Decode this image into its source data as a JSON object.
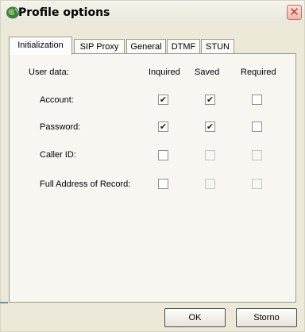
{
  "window": {
    "title": "Profile options",
    "close_glyph": "✕",
    "icon": "globe-icon"
  },
  "tabs": [
    {
      "label": "Initialization",
      "active": true
    },
    {
      "label": "SIP Proxy",
      "active": false
    },
    {
      "label": "General",
      "active": false
    },
    {
      "label": "DTMF",
      "active": false
    },
    {
      "label": "STUN",
      "active": false
    }
  ],
  "table": {
    "section_label": "User data:",
    "columns": [
      "Inquired",
      "Saved",
      "Required"
    ],
    "rows": [
      {
        "label": "Account:",
        "inquired": true,
        "saved": true,
        "required": false
      },
      {
        "label": "Password:",
        "inquired": true,
        "saved": true,
        "required": false
      },
      {
        "label": "Caller ID:",
        "inquired": false,
        "saved": false,
        "required": false
      },
      {
        "label": "Full Address of Record:",
        "inquired": false,
        "saved": false,
        "required": false
      }
    ]
  },
  "buttons": {
    "ok": "OK",
    "cancel": "Storno"
  },
  "check_glyph": "✔"
}
